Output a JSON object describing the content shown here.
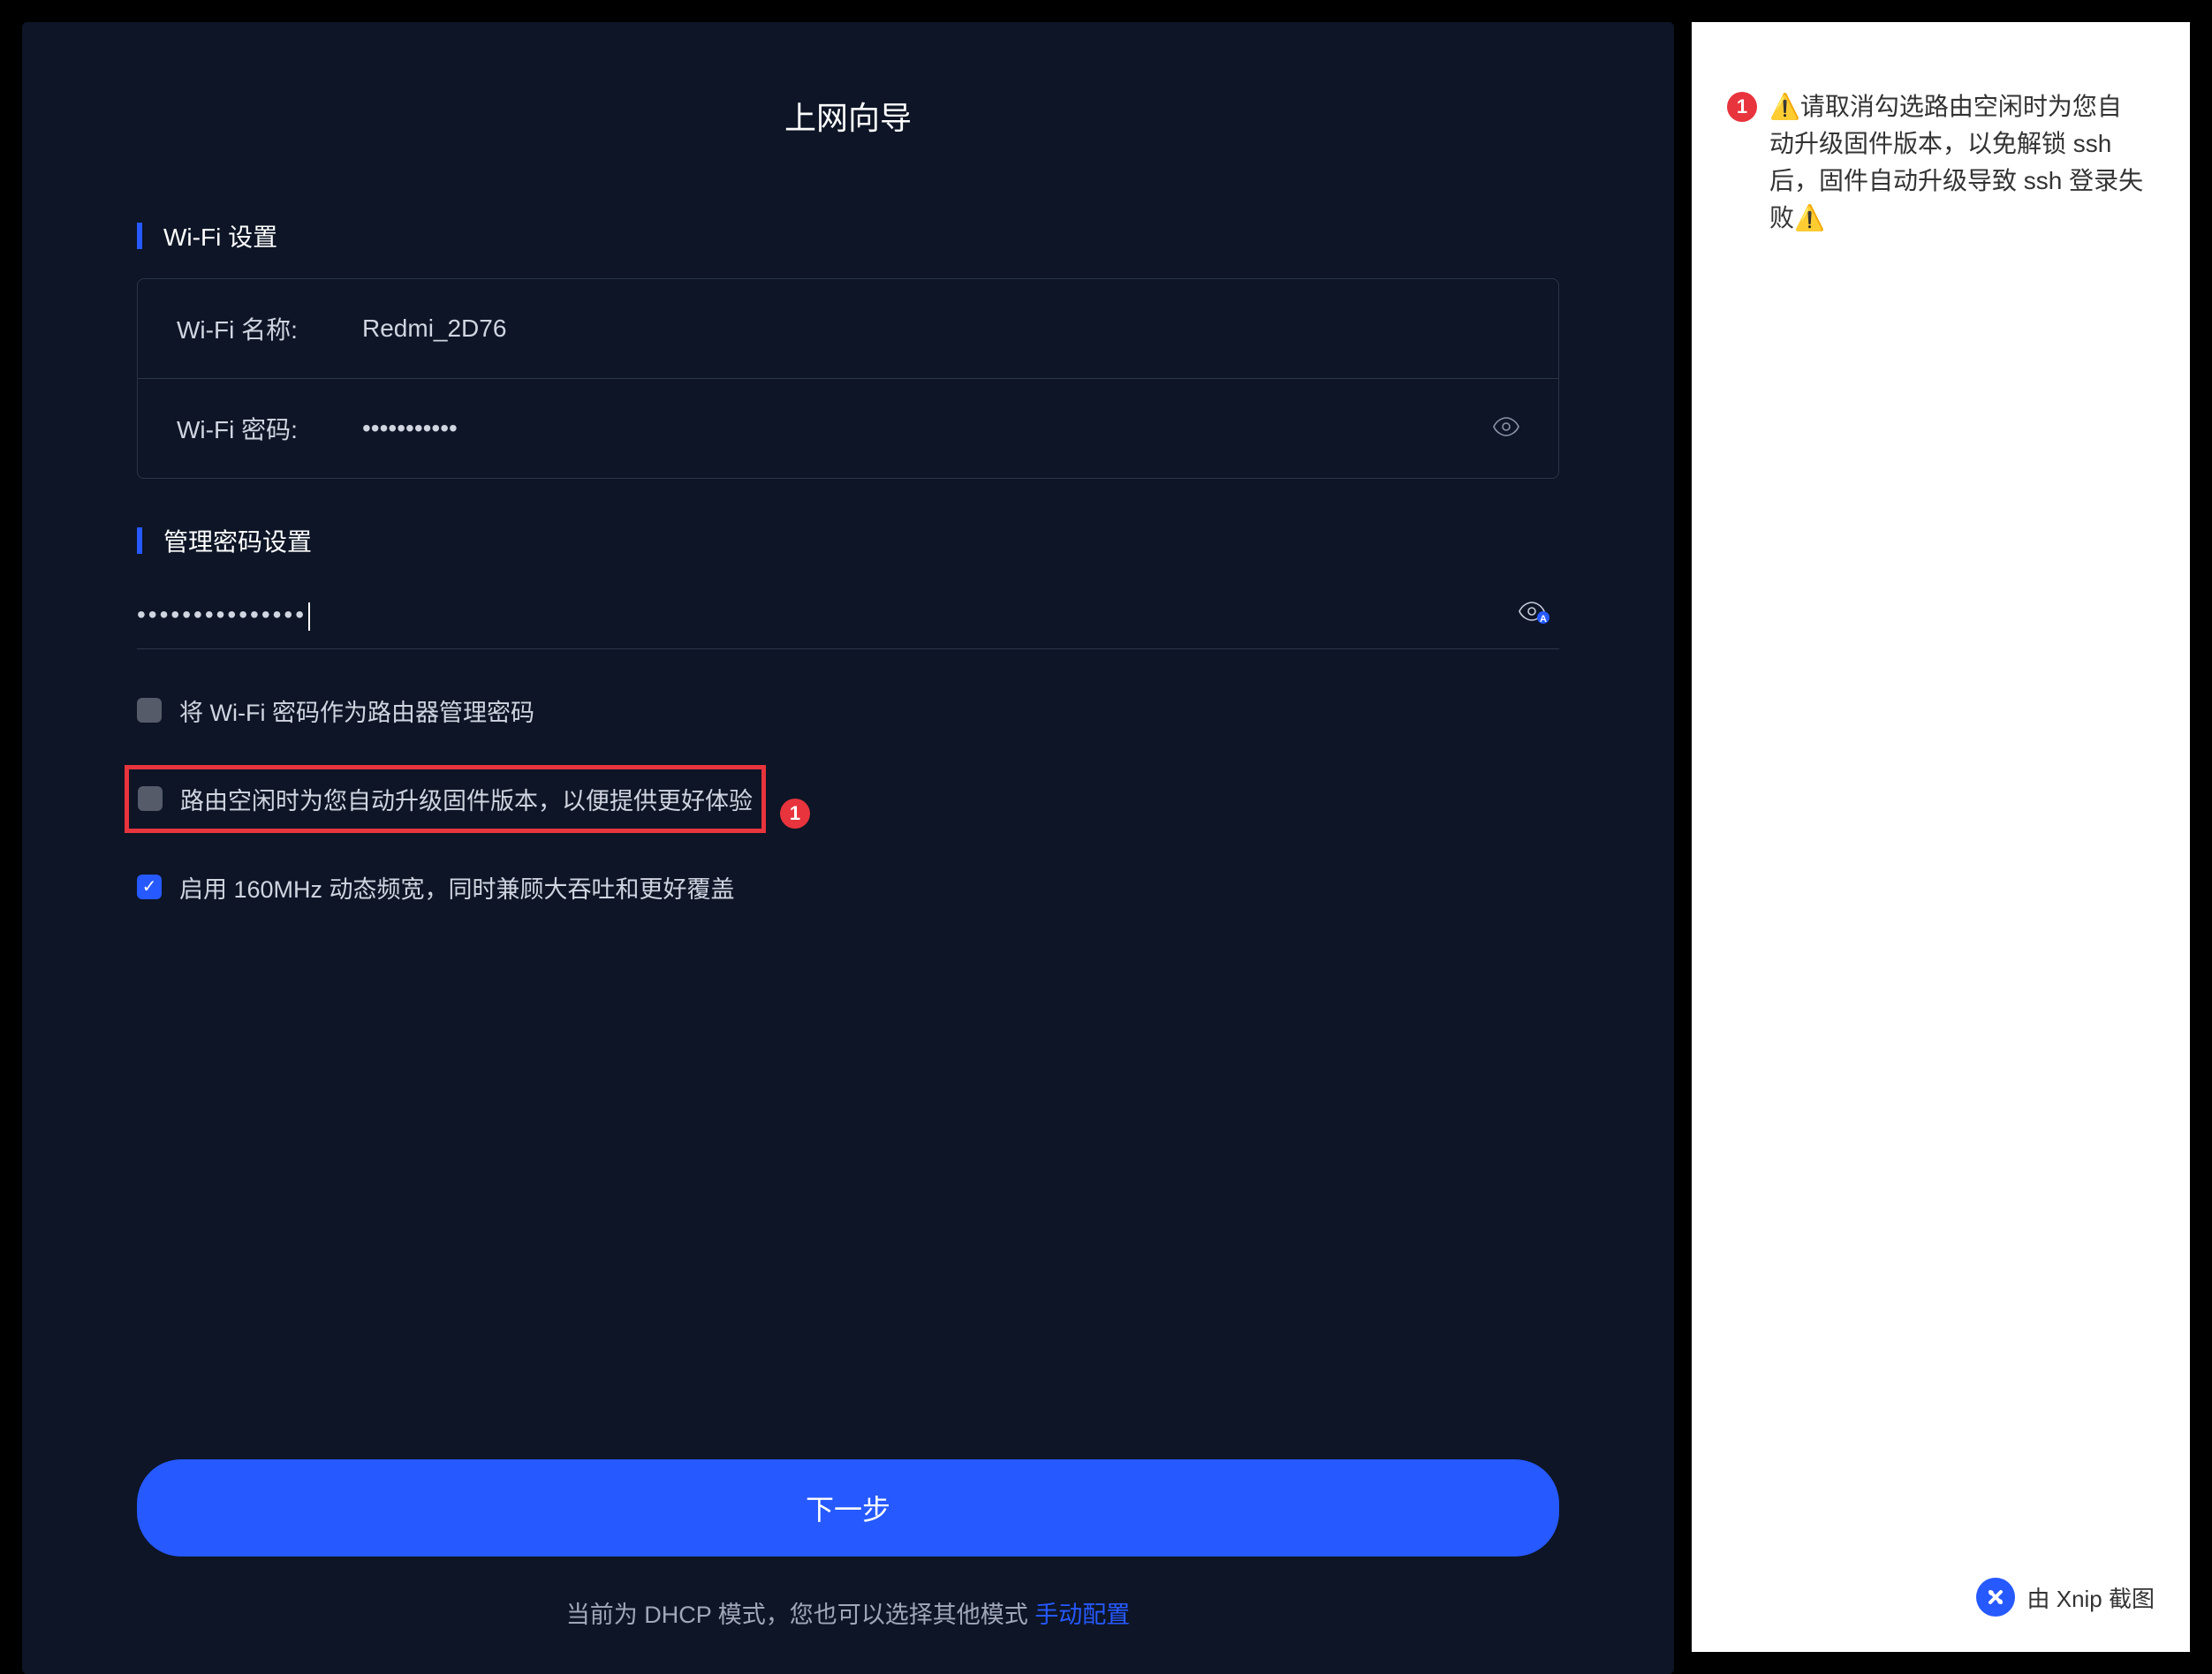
{
  "page": {
    "title": "上网向导"
  },
  "wifi_section": {
    "title": "Wi-Fi 设置",
    "name_label": "Wi-Fi 名称:",
    "name_value": "Redmi_2D76",
    "password_label": "Wi-Fi 密码:",
    "password_value": "•••••••••••"
  },
  "admin_section": {
    "title": "管理密码设置",
    "password_value": "•••••••••••••••"
  },
  "checkboxes": {
    "use_wifi_password": {
      "label": "将 Wi-Fi 密码作为路由器管理密码",
      "checked": false
    },
    "auto_upgrade": {
      "label": "路由空闲时为您自动升级固件版本，以便提供更好体验",
      "checked": false,
      "badge": "1"
    },
    "enable_160mhz": {
      "label": "启用 160MHz 动态频宽，同时兼顾大吞吐和更好覆盖",
      "checked": true
    }
  },
  "actions": {
    "next_button": "下一步"
  },
  "footer": {
    "mode_text": "当前为 DHCP 模式，您也可以选择其他模式 ",
    "link_text": "手动配置"
  },
  "annotation": {
    "badge": "1",
    "text": "⚠️请取消勾选路由空闲时为您自动升级固件版本，以免解锁 ssh 后，固件自动升级导致 ssh 登录失败⚠️"
  },
  "watermark": {
    "text": "由 Xnip 截图"
  }
}
